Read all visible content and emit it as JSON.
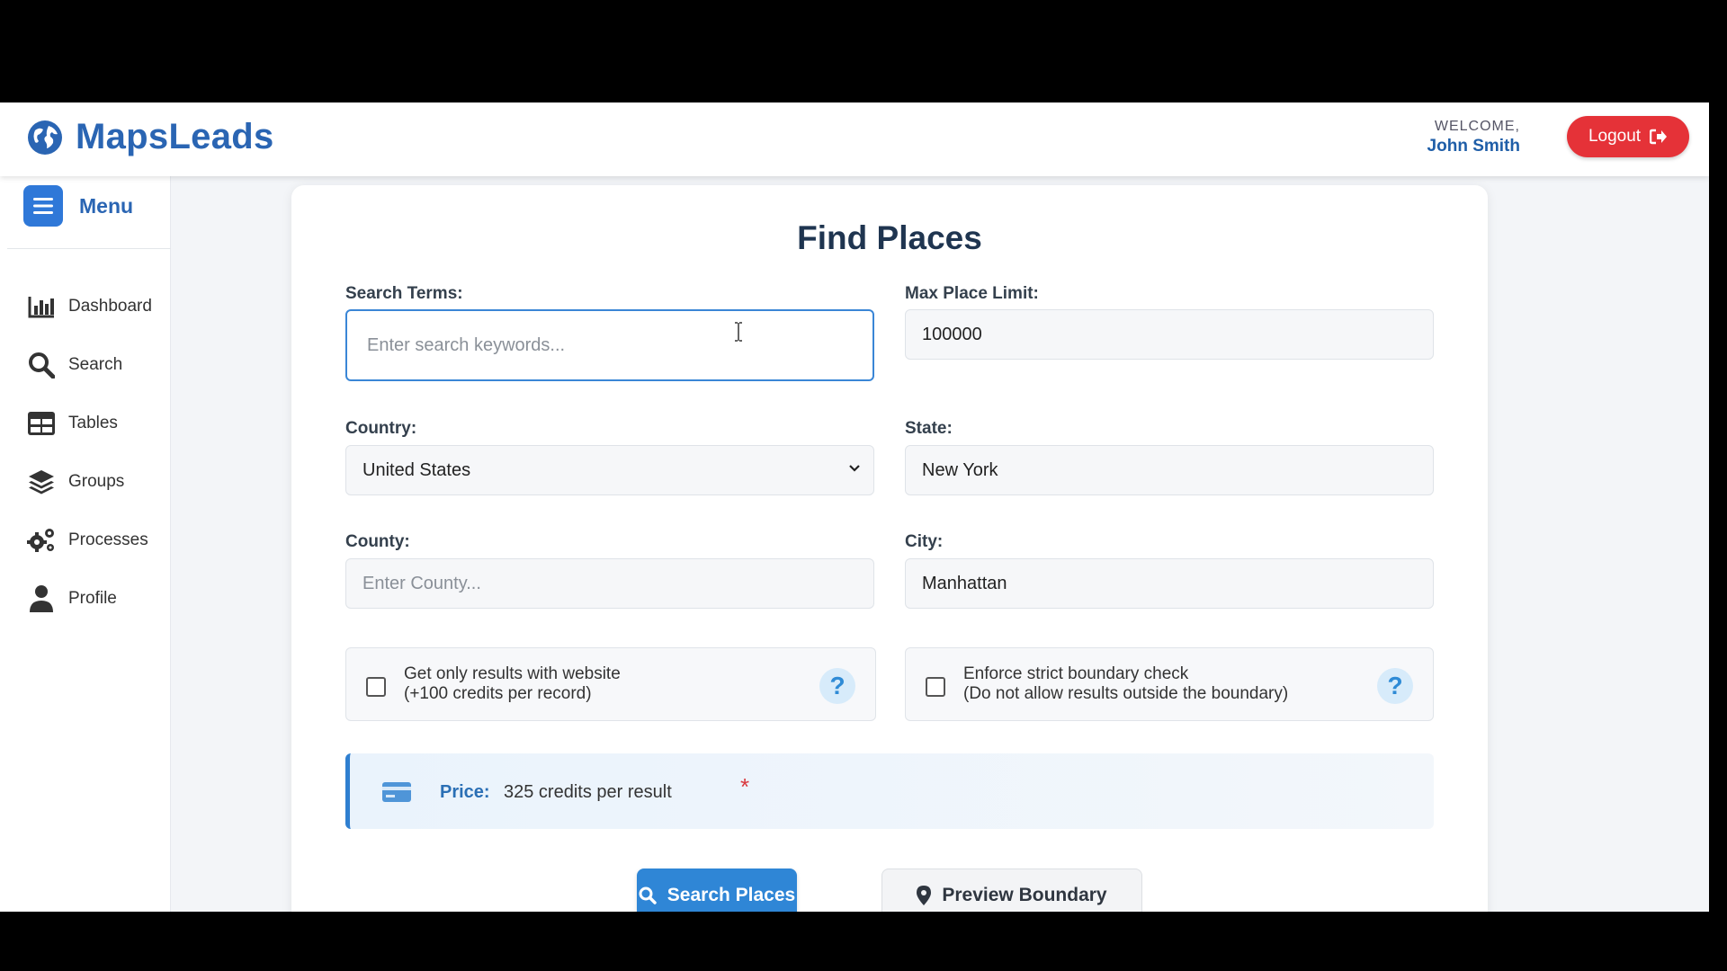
{
  "app": {
    "name": "MapsLeads",
    "welcome_label": "WELCOME,",
    "user_name": "John Smith",
    "logout_label": "Logout"
  },
  "sidebar": {
    "menu_label": "Menu",
    "items": [
      {
        "label": "Dashboard",
        "icon": "bar-chart-icon"
      },
      {
        "label": "Search",
        "icon": "search-icon"
      },
      {
        "label": "Tables",
        "icon": "table-icon"
      },
      {
        "label": "Groups",
        "icon": "layers-icon"
      },
      {
        "label": "Processes",
        "icon": "gears-icon"
      },
      {
        "label": "Profile",
        "icon": "user-icon"
      }
    ]
  },
  "form": {
    "title": "Find Places",
    "search_terms": {
      "label": "Search Terms:",
      "value": "",
      "placeholder": "Enter search keywords..."
    },
    "max_limit": {
      "label": "Max Place Limit:",
      "value": "100000"
    },
    "country": {
      "label": "Country:",
      "value": "United States"
    },
    "state": {
      "label": "State:",
      "value": "New York"
    },
    "county": {
      "label": "County:",
      "value": "",
      "placeholder": "Enter County..."
    },
    "city": {
      "label": "City:",
      "value": "Manhattan"
    },
    "website_check": {
      "line1": "Get only results with website",
      "line2": "(+100 credits per record)",
      "checked": false
    },
    "boundary_check": {
      "line1": "Enforce strict boundary check",
      "line2": "(Do not allow results outside the boundary)",
      "checked": false
    },
    "help_glyph": "?",
    "price": {
      "label": "Price:",
      "value": "325 credits per result",
      "asterisk": "*"
    },
    "search_button": "Search Places",
    "preview_button": "Preview Boundary"
  },
  "colors": {
    "brand": "#2a65b3",
    "accent": "#2f86d6",
    "logout": "#e53238"
  }
}
